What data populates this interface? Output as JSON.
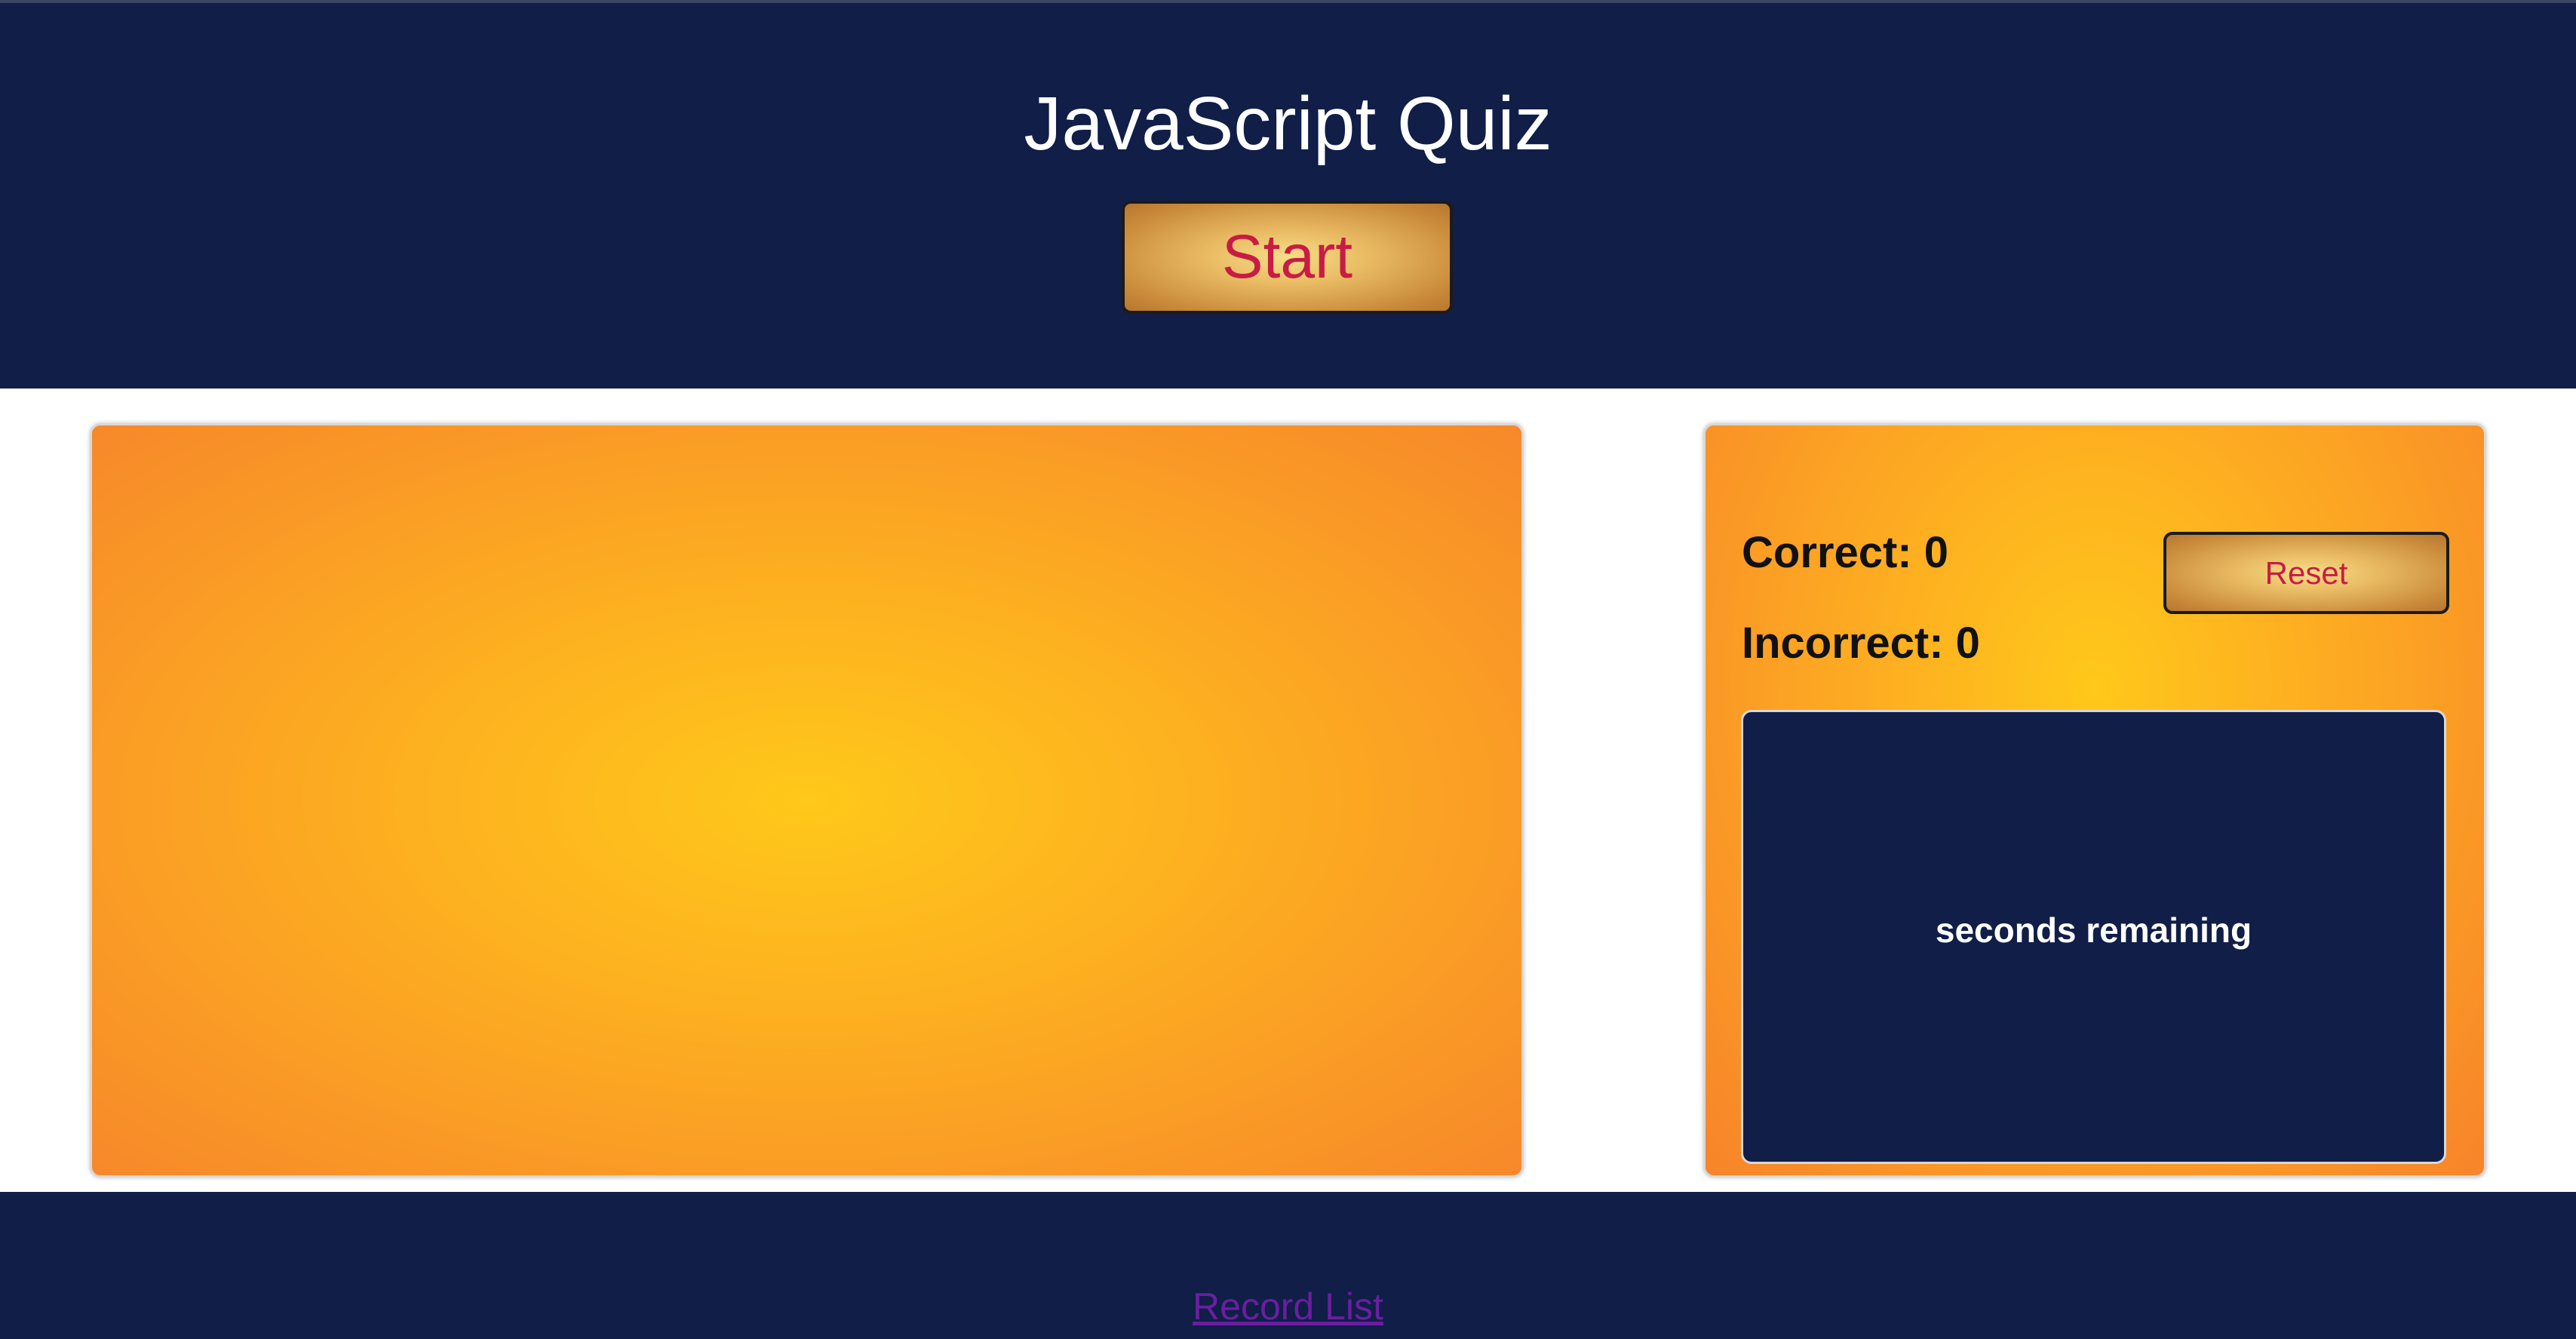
{
  "header": {
    "title": "JavaScript Quiz",
    "start_label": "Start"
  },
  "scoreboard": {
    "correct_label": "Correct: 0",
    "incorrect_label": "Incorrect: 0",
    "reset_label": "Reset",
    "timer_text": "seconds remaining"
  },
  "footer": {
    "record_link_label": "Record List"
  },
  "colors": {
    "navy": "#101e48",
    "orange": "#f7882a",
    "yellow": "#ffc81a",
    "button_text": "#c81c44",
    "link": "#6a1ea0"
  }
}
